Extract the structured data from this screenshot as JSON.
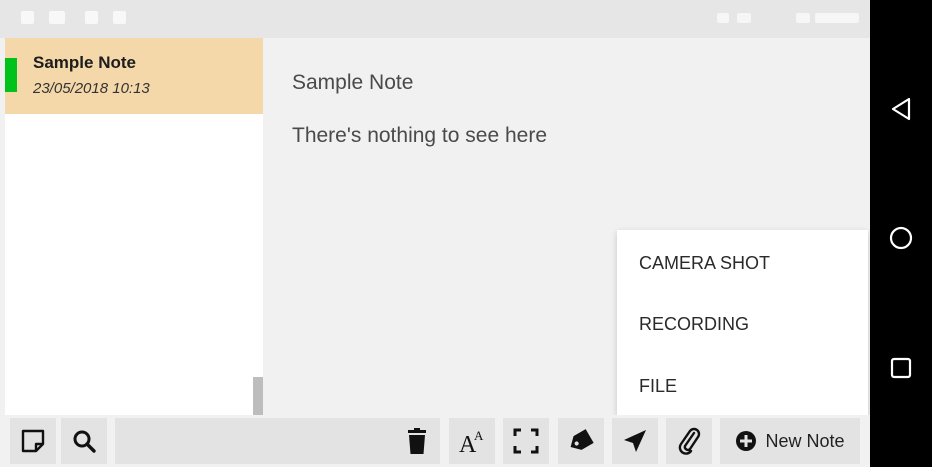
{
  "notes": [
    {
      "title": "Sample Note",
      "date": "23/05/2018 10:13",
      "color": "#00c21a",
      "highlight": "#f4d8aa"
    }
  ],
  "editor": {
    "title": "Sample Note",
    "content": "There's nothing to see here"
  },
  "attach_menu": {
    "items": [
      {
        "label": "CAMERA SHOT"
      },
      {
        "label": "RECORDING"
      },
      {
        "label": "FILE"
      }
    ]
  },
  "toolbar": {
    "new_note_label": "New Note",
    "icons": [
      "notes-list-icon",
      "search-icon",
      "trash-icon",
      "text-format-icon",
      "fullscreen-icon",
      "tag-icon",
      "send-icon",
      "attachment-icon",
      "plus-circle-icon"
    ]
  },
  "system_nav": {
    "icons": [
      "back-icon",
      "home-icon",
      "recents-icon"
    ]
  }
}
